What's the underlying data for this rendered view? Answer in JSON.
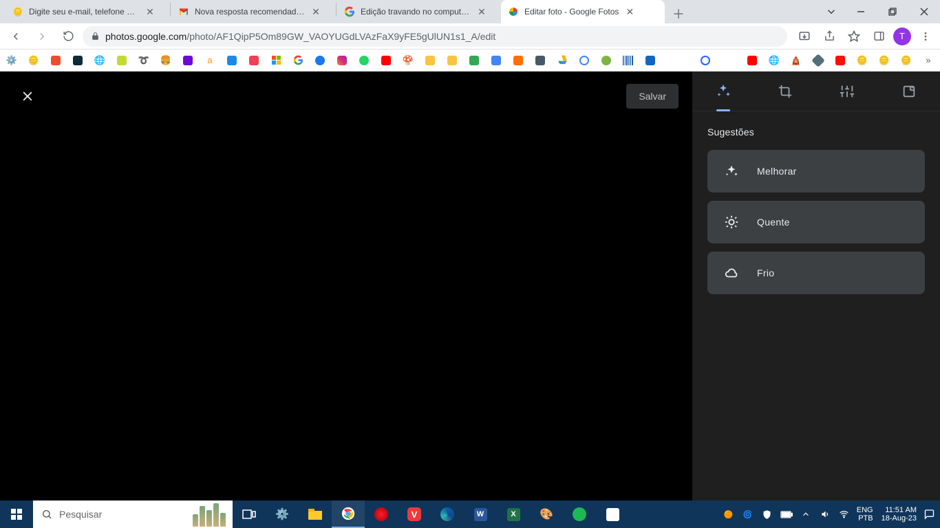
{
  "browser": {
    "tabs": [
      {
        "title": "Digite seu e-mail, telefone ou usu"
      },
      {
        "title": "Nova resposta recomendada para"
      },
      {
        "title": "Edição travando no computador"
      },
      {
        "title": "Editar foto - Google Fotos"
      }
    ],
    "url_host": "photos.google.com",
    "url_path": "/photo/AF1QipP5Om89GW_VAOYUGdLVAzFaX9yFE5gUlUN1s1_A/edit",
    "avatar_initial": "T"
  },
  "editor": {
    "save_label": "Salvar",
    "section_title": "Sugestões",
    "suggestions": [
      {
        "label": "Melhorar"
      },
      {
        "label": "Quente"
      },
      {
        "label": "Frio"
      }
    ]
  },
  "taskbar": {
    "search_placeholder": "Pesquisar",
    "lang_top": "ENG",
    "lang_bottom": "PTB",
    "time": "11:51 AM",
    "date": "18-Aug-23"
  }
}
